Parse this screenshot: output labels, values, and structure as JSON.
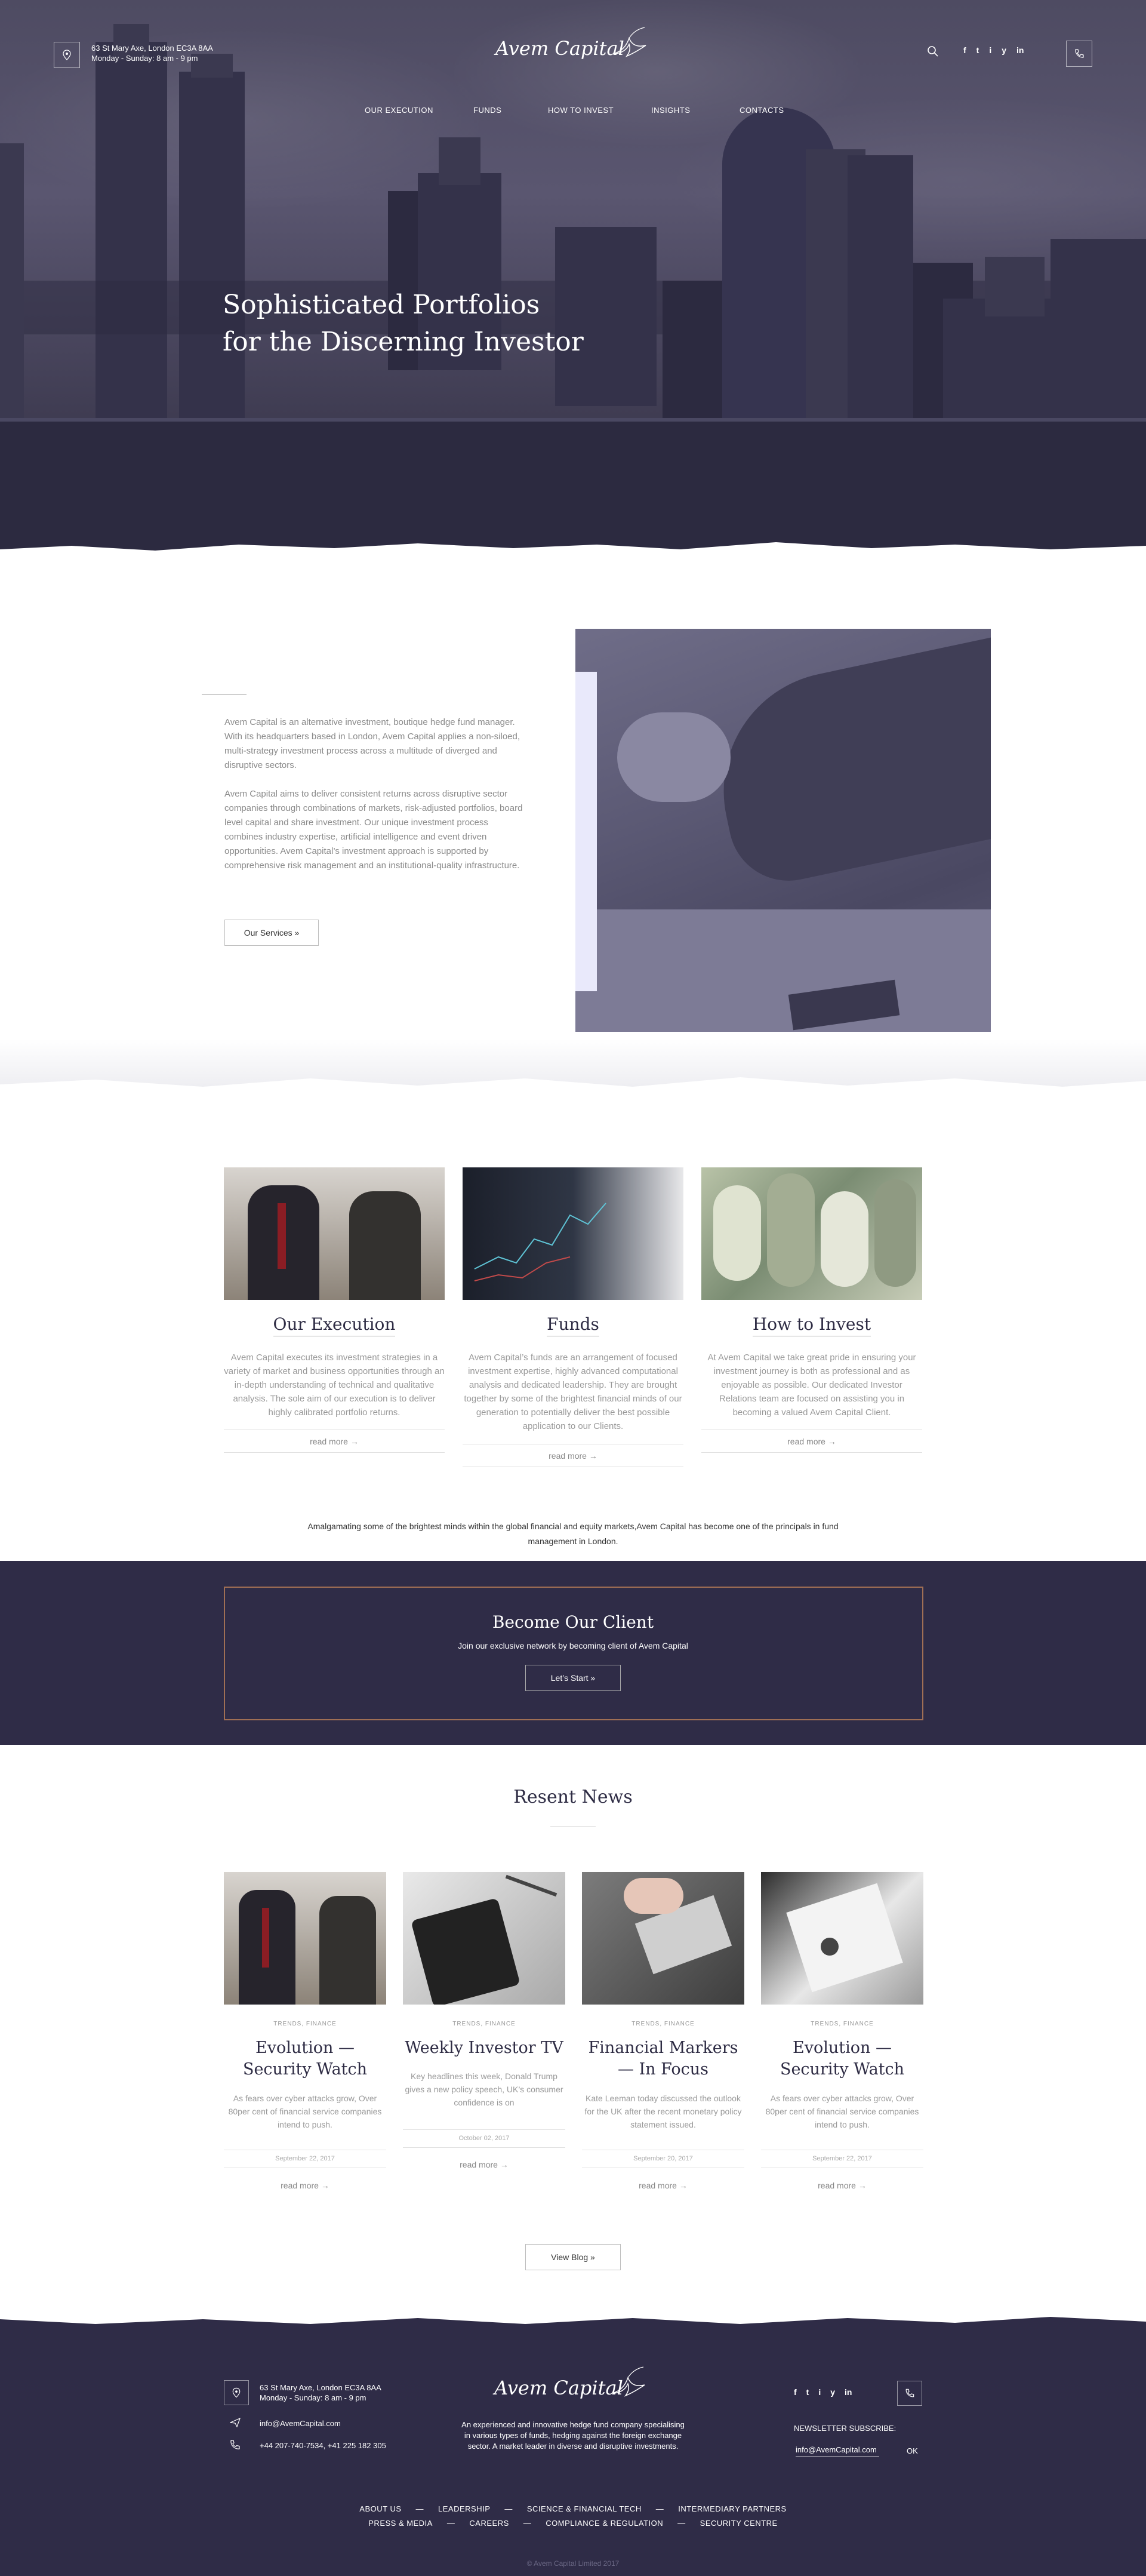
{
  "header": {
    "address_line1": "63 St Mary Axe, London EC3A 8AA",
    "address_line2": "Monday - Sunday: 8 am - 9 pm",
    "logo_text": "Avem Capital",
    "social": [
      "f",
      "t",
      "i",
      "y",
      "in"
    ],
    "nav": [
      "OUR EXECUTION",
      "FUNDS",
      "HOW TO INVEST",
      "INSIGHTS",
      "CONTACTS"
    ]
  },
  "hero": {
    "title_line1": "Sophisticated Portfolios",
    "title_line2": "for the Discerning Investor"
  },
  "about": {
    "p1": "Avem Capital is an alternative investment, boutique hedge fund manager. With its headquarters based in London, Avem Capital applies a non-siloed, multi-strategy investment process across a multitude of diverged and disruptive sectors.",
    "p2": "Avem Capital aims to deliver consistent returns across disruptive sector companies through combinations of markets, risk-adjusted portfolios, board level capital and share investment. Our unique investment process combines industry expertise, artificial intelligence and event driven opportunities. Avem Capital’s investment approach is supported by comprehensive risk management and an institutional-quality infrastructure.",
    "button": "Our Services »"
  },
  "services": [
    {
      "title": "Our Execution",
      "desc": "Avem Capital executes its investment strategies in a variety of market and business opportunities through an in-depth understanding of technical and qualitative analysis. The sole aim of our execution is to deliver highly calibrated portfolio returns.",
      "more": "read more →"
    },
    {
      "title": "Funds",
      "desc": "Avem Capital’s funds are an arrangement of focused investment expertise, highly advanced computational analysis and dedicated leadership. They are brought together by some of the brightest financial minds of our generation to potentially deliver the best possible application to our Clients.",
      "more": "read more →"
    },
    {
      "title": "How to Invest",
      "desc": "At Avem Capital we take great pride in ensuring your investment journey is both as professional and as enjoyable as possible. Our dedicated Investor Relations team are focused on assisting you in becoming a valued Avem Capital Client.",
      "more": "read more →"
    }
  ],
  "tagline": "Amalgamating some of the brightest minds within the global financial and equity markets,Avem Capital has become one of the principals in fund management in London.",
  "cta": {
    "title": "Become Our Client",
    "subtitle": "Join our exclusive network by becoming client of Avem Capital",
    "button": "Let’s Start »"
  },
  "news": {
    "heading": "Resent News",
    "items": [
      {
        "category": "TRENDS, FINANCE",
        "title": "Evolution — Security Watch",
        "excerpt": "As fears over cyber attacks grow, Over 80per cent of financial service companies intend to push.",
        "date": "September 22, 2017",
        "more": "read more →"
      },
      {
        "category": "TRENDS, FINANCE",
        "title": "Weekly Investor TV",
        "excerpt": "Key headlines this week, Donald Trump gives a new policy speech, UK’s consumer confidence is on",
        "date": "October 02, 2017",
        "more": "read more →"
      },
      {
        "category": "TRENDS, FINANCE",
        "title": "Financial Markers — In Focus",
        "excerpt": "Kate Leeman today discussed the outlook for the UK after the recent monetary policy statement issued.",
        "date": "September 20, 2017",
        "more": "read more →"
      },
      {
        "category": "TRENDS, FINANCE",
        "title": "Evolution — Security Watch",
        "excerpt": "As fears over cyber attacks grow, Over 80per cent of financial service companies intend to push.",
        "date": "September 22, 2017",
        "more": "read more →"
      }
    ],
    "view_blog": "View Blog »"
  },
  "footer": {
    "address_line1": "63 St Mary Axe, London EC3A 8AA",
    "address_line2": "Monday - Sunday: 8 am - 9 pm",
    "email": "info@AvemCapital.com",
    "phones": "+44 207-740-7534, +41 225 182 305",
    "logo_text": "Avem Capital",
    "about": "An experienced and innovative hedge fund company specialising in various types of funds, hedging against the foreign exchange sector. A market leader in diverse and disruptive investments.",
    "newsletter_label": "NEWSLETTER SUBSCRIBE:",
    "newsletter_value": "info@AvemCapital.com",
    "newsletter_button": "OK",
    "links_row1": [
      "ABOUT US",
      "—",
      "LEADERSHIP",
      "—",
      "SCIENCE & FINANCIAL TECH",
      "—",
      "INTERMEDIARY PARTNERS"
    ],
    "links_row2": [
      "PRESS & MEDIA",
      "—",
      "CAREERS",
      "—",
      "COMPLIANCE & REGULATION",
      "—",
      "SECURITY CENTRE"
    ],
    "copyright": "© Avem Capital Limited 2017"
  },
  "colors": {
    "navy": "#2f2c47",
    "hero": "#4e4b62",
    "accent_frame": "#a06f54",
    "lavender": "#e9e9fb"
  }
}
